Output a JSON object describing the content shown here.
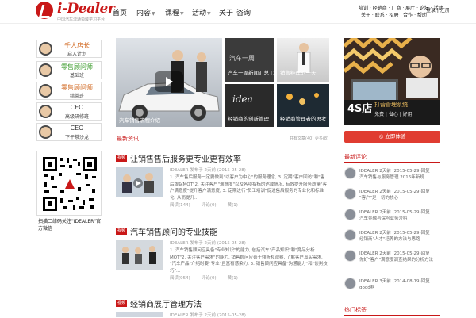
{
  "header": {
    "logo_text": "i-Dealer",
    "logo_sub": "中国汽车流通领域学习平台",
    "nav": [
      {
        "label": "首页",
        "dropdown": false
      },
      {
        "label": "内容",
        "dropdown": true
      },
      {
        "label": "课程",
        "dropdown": true
      },
      {
        "label": "活动",
        "dropdown": true
      },
      {
        "label": "关于",
        "dropdown": false
      },
      {
        "label": "咨询",
        "dropdown": false
      }
    ],
    "top_links_row1": "培训 · 经销商 · 厂商 · 展厅 · 论坛 · 活动",
    "top_links_row2": "关于 · 联系 · 招聘 · 合作 · 帮助",
    "login_links": "登录 | 注册"
  },
  "left_sidebar": {
    "items": [
      {
        "role": "千人店长",
        "sub": "启入计划",
        "color": "orange"
      },
      {
        "role": "零售顾问师",
        "sub": "基础班",
        "color": "green"
      },
      {
        "role": "零售顾问师",
        "sub": "精英班",
        "color": "orange"
      },
      {
        "role": "CEO",
        "sub": "高级研修班",
        "color": "plain"
      },
      {
        "role": "CEO",
        "sub": "下午茶沙龙",
        "color": "plain"
      }
    ],
    "qr_caption": "扫描二维码关注\"IDEALER\"官方微信"
  },
  "hero": {
    "main_caption": "汽车销售流程介绍",
    "tile_2_caption": "汽车一周新闻汇总 [10月]",
    "tile_2_text": "汽车一周",
    "tile_3_caption": "销售经理的一天",
    "tile_4_caption": "经销商的创新管理",
    "tile_4_text": "idea",
    "tile_5_caption": "经销商管理者的思考"
  },
  "news": {
    "section_title": "最新资讯",
    "meta_left": "共有文章(40)",
    "meta_right": "更多(8)"
  },
  "articles": [
    {
      "tag": "视频",
      "title": "让销售售后服务更专业更有效率",
      "meta": "IDEALER 发布于 2天前 (2015-05-28)",
      "body": "1. 汽车售后服务一定要做到\"以客户为中心\"的服务理念, 3. 定期\"客户回访\"和\"售后跟踪MOT\"2. 关注客户\"满意度\"以及各项指标的达成情况, 有效提升服务质量\"客户满意度\"提升客户满意度, 3. 定期进行\"员工培训\"促进售后服务的专业化和标准化, 从而提升...",
      "views": "阅读(144)",
      "comments": "评论(0)",
      "likes": "赞(1)"
    },
    {
      "tag": "视频",
      "title": "汽车销售顾问的专业技能",
      "meta": "IDEALER 发布于 2天前 (2015-05-28)",
      "body": "1. 汽车销售顾问应具备\"专业知识\"的能力, 包括汽车\"产品知识\"和\"竞品分析MOT\"2. 关注客户需求\"的能力, 销售顾问应善于倾听和观察, 了解客户真实需求, \"汽车产品\"介绍时要\"专业\"且富有感染力, 3. 销售顾问应具备\"沟通能力\"和\"谈判技巧\"...",
      "views": "阅读(954)",
      "comments": "评论(0)",
      "likes": "赞(1)"
    },
    {
      "tag": "视频",
      "title": "经销商展厅管理方法",
      "meta": "IDEALER 发布于 2天前 (2015-05-28)"
    }
  ],
  "right_sidebar": {
    "ad_title": "4S店",
    "ad_subtitle": "打营管理系统",
    "ad_tagline": "免费 | 省心 | 好用",
    "ad_button": "◎ 立即体验",
    "comments_title": "最新评论",
    "comments": [
      {
        "line1": "IDEALER 2天前 (2015-05-29)回复",
        "line2": "汽车销售与服务管理 2016年新规"
      },
      {
        "line1": "IDEALER 2天前 (2015-05-29)回复",
        "line2": "\"客户\"是一切的核心"
      },
      {
        "line1": "IDEALER 2天前 (2015-05-29)回复",
        "line2": "汽车金融与保险业务介绍"
      },
      {
        "line1": "IDEALER 2天前 (2015-05-29)回复",
        "line2": "经销商\"人才\"培养的方法与思路"
      },
      {
        "line1": "IDEALER 2天前 (2015-05-29)回复",
        "line2": "你好\"客户\"满意度调查结果的分析方法"
      },
      {
        "line1": "IDEALER 3天前 (2014-08-19)回复",
        "line2": "good啊"
      }
    ],
    "bottom_title": "热门标签"
  }
}
